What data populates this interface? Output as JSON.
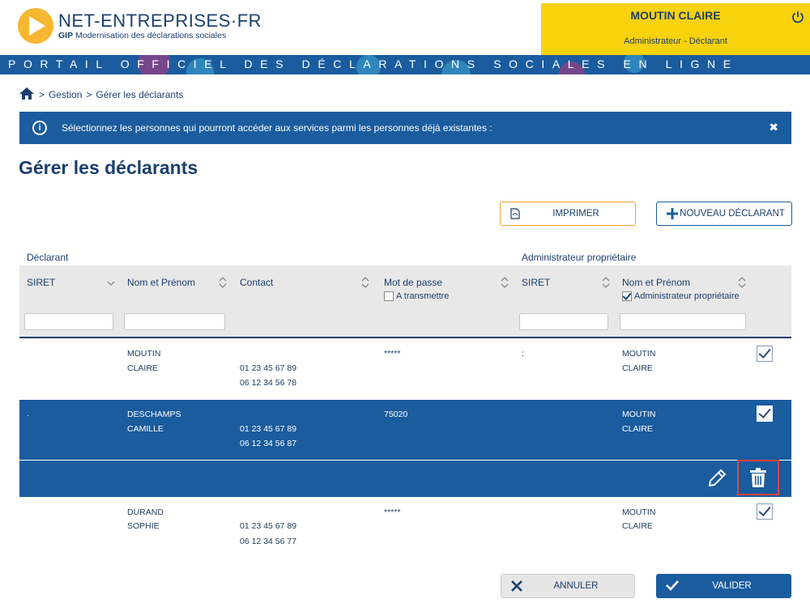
{
  "logo": {
    "title": "NET-ENTREPRISES·FR",
    "sub_bold": "GIP",
    "sub": " Modernisation des déclarations sociales"
  },
  "user": {
    "name": "MOUTIN CLAIRE",
    "role": "Administrateur - Déclarant"
  },
  "banner": "PORTAIL OFFICIEL DES DÉCLARATIONS SOCIALES EN LIGNE",
  "breadcrumb": {
    "sep1": ">",
    "item1": "Gestion",
    "sep2": ">",
    "item2": "Gérer les déclarants"
  },
  "info": {
    "text": "Sélectionnez les personnes qui pourront accéder aux services parmi les personnes déjà existantes :",
    "close": "✖",
    "icon": "i"
  },
  "page_title": "Gérer les déclarants",
  "buttons": {
    "print": "IMPRIMER",
    "new": "NOUVEAU DÉCLARANT",
    "cancel": "ANNULER",
    "validate": "VALIDER"
  },
  "table": {
    "group_declarant": "Déclarant",
    "group_admin": "Administrateur propriétaire",
    "headers": {
      "siret": "SIRET",
      "nom": "Nom et Prénom",
      "contact": "Contact",
      "mdp": "Mot de passe",
      "siret2": "SIRET",
      "nom2": "Nom et Prénom"
    },
    "checkbox_transmettre": "A transmettre",
    "checkbox_admin": "Administrateur propriétaire",
    "rows": [
      {
        "siret": "",
        "nom": "MOUTIN",
        "prenom": "CLAIRE",
        "tel1": "01 23 45 67 89",
        "tel2": "06 12 34 56 78",
        "mdp": "*****",
        "siret2": ":",
        "admin_nom": "MOUTIN",
        "admin_prenom": "CLAIRE"
      },
      {
        "siret": ".",
        "nom": "DESCHAMPS",
        "prenom": "CAMILLE",
        "tel1": "01 23 45 67 89",
        "tel2": "06 12 34 56 87",
        "mdp": "75020",
        "siret2": "",
        "admin_nom": "MOUTIN",
        "admin_prenom": "CLAIRE"
      },
      {
        "siret": "",
        "nom": "DURAND",
        "prenom": "SOPHIE",
        "tel1": "01 23 45 67 89",
        "tel2": "06 12 34 56 77",
        "mdp": "*****",
        "siret2": "",
        "admin_nom": "MOUTIN",
        "admin_prenom": "CLAIRE"
      }
    ]
  },
  "colors": {
    "brand_blue": "#1a5c9e",
    "yellow": "#f9d20e",
    "orange": "#f0a030",
    "red_highlight": "#e2433f"
  }
}
